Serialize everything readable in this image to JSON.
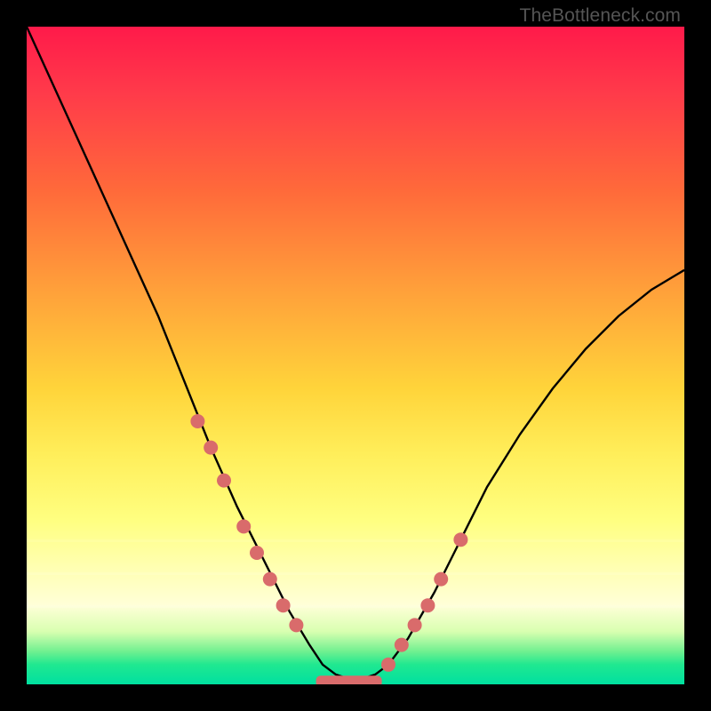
{
  "attribution": "TheBottleneck.com",
  "chart_data": {
    "type": "line",
    "title": "",
    "xlabel": "",
    "ylabel": "",
    "xlim": [
      0,
      100
    ],
    "ylim": [
      0,
      100
    ],
    "x": [
      0,
      5,
      10,
      15,
      20,
      24,
      28,
      32,
      36,
      40,
      43,
      45,
      47,
      50,
      53,
      55,
      58,
      62,
      66,
      70,
      75,
      80,
      85,
      90,
      95,
      100
    ],
    "values": [
      100,
      89,
      78,
      67,
      56,
      46,
      36,
      27,
      19,
      11,
      6,
      3,
      1.5,
      0.5,
      1.5,
      3,
      7,
      14,
      22,
      30,
      38,
      45,
      51,
      56,
      60,
      63
    ],
    "markers_left": {
      "x": [
        26,
        28,
        30,
        33,
        35,
        37,
        39,
        41
      ],
      "values": [
        40,
        36,
        31,
        24,
        20,
        16,
        12,
        9
      ]
    },
    "markers_right": {
      "x": [
        55,
        57,
        59,
        61,
        63,
        66
      ],
      "values": [
        3,
        6,
        9,
        12,
        16,
        22
      ]
    },
    "flat_segment": {
      "x_start": 44,
      "x_end": 54,
      "value": 0.5
    },
    "color_stops": [
      {
        "pos": 0,
        "color": "#ff1a4a"
      },
      {
        "pos": 25,
        "color": "#ff6a3a"
      },
      {
        "pos": 55,
        "color": "#ffd43a"
      },
      {
        "pos": 82,
        "color": "#ffffb0"
      },
      {
        "pos": 95,
        "color": "#70f090"
      },
      {
        "pos": 100,
        "color": "#00e0a0"
      }
    ]
  }
}
